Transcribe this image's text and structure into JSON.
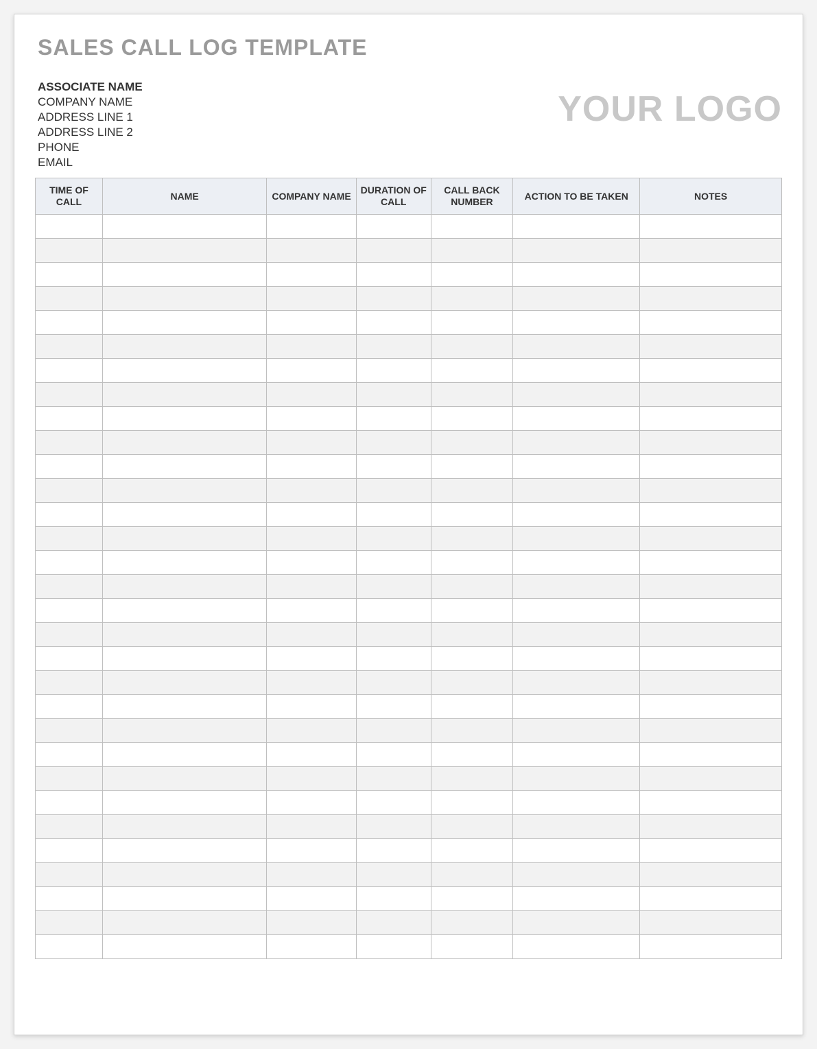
{
  "title": "SALES CALL LOG TEMPLATE",
  "logo_text": "YOUR LOGO",
  "sender": {
    "name": "ASSOCIATE NAME",
    "company": "COMPANY NAME",
    "address1": "ADDRESS LINE 1",
    "address2": "ADDRESS LINE 2",
    "phone": "PHONE",
    "email": "EMAIL"
  },
  "columns": [
    "TIME OF CALL",
    "NAME",
    "COMPANY NAME",
    "DURATION OF CALL",
    "CALL BACK NUMBER",
    "ACTION TO BE TAKEN",
    "NOTES"
  ],
  "rows": [
    [
      "",
      "",
      "",
      "",
      "",
      "",
      ""
    ],
    [
      "",
      "",
      "",
      "",
      "",
      "",
      ""
    ],
    [
      "",
      "",
      "",
      "",
      "",
      "",
      ""
    ],
    [
      "",
      "",
      "",
      "",
      "",
      "",
      ""
    ],
    [
      "",
      "",
      "",
      "",
      "",
      "",
      ""
    ],
    [
      "",
      "",
      "",
      "",
      "",
      "",
      ""
    ],
    [
      "",
      "",
      "",
      "",
      "",
      "",
      ""
    ],
    [
      "",
      "",
      "",
      "",
      "",
      "",
      ""
    ],
    [
      "",
      "",
      "",
      "",
      "",
      "",
      ""
    ],
    [
      "",
      "",
      "",
      "",
      "",
      "",
      ""
    ],
    [
      "",
      "",
      "",
      "",
      "",
      "",
      ""
    ],
    [
      "",
      "",
      "",
      "",
      "",
      "",
      ""
    ],
    [
      "",
      "",
      "",
      "",
      "",
      "",
      ""
    ],
    [
      "",
      "",
      "",
      "",
      "",
      "",
      ""
    ],
    [
      "",
      "",
      "",
      "",
      "",
      "",
      ""
    ],
    [
      "",
      "",
      "",
      "",
      "",
      "",
      ""
    ],
    [
      "",
      "",
      "",
      "",
      "",
      "",
      ""
    ],
    [
      "",
      "",
      "",
      "",
      "",
      "",
      ""
    ],
    [
      "",
      "",
      "",
      "",
      "",
      "",
      ""
    ],
    [
      "",
      "",
      "",
      "",
      "",
      "",
      ""
    ],
    [
      "",
      "",
      "",
      "",
      "",
      "",
      ""
    ],
    [
      "",
      "",
      "",
      "",
      "",
      "",
      ""
    ],
    [
      "",
      "",
      "",
      "",
      "",
      "",
      ""
    ],
    [
      "",
      "",
      "",
      "",
      "",
      "",
      ""
    ],
    [
      "",
      "",
      "",
      "",
      "",
      "",
      ""
    ],
    [
      "",
      "",
      "",
      "",
      "",
      "",
      ""
    ],
    [
      "",
      "",
      "",
      "",
      "",
      "",
      ""
    ],
    [
      "",
      "",
      "",
      "",
      "",
      "",
      ""
    ],
    [
      "",
      "",
      "",
      "",
      "",
      "",
      ""
    ],
    [
      "",
      "",
      "",
      "",
      "",
      "",
      ""
    ],
    [
      "",
      "",
      "",
      "",
      "",
      "",
      ""
    ]
  ]
}
